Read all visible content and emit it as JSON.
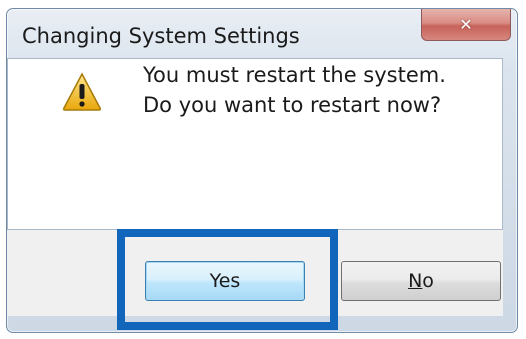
{
  "window": {
    "title": "Changing System Settings",
    "close_icon": "close-icon"
  },
  "dialog": {
    "icon": "warning-icon",
    "message_line1": "You must restart the system.",
    "message_line2": "Do you want to restart now?"
  },
  "buttons": {
    "yes_label": "Yes",
    "no_mnemonic": "N",
    "no_rest": "o"
  },
  "colors": {
    "highlight": "#1166bb",
    "warning_fill": "#f5c518",
    "close_button": "#c7635a"
  }
}
